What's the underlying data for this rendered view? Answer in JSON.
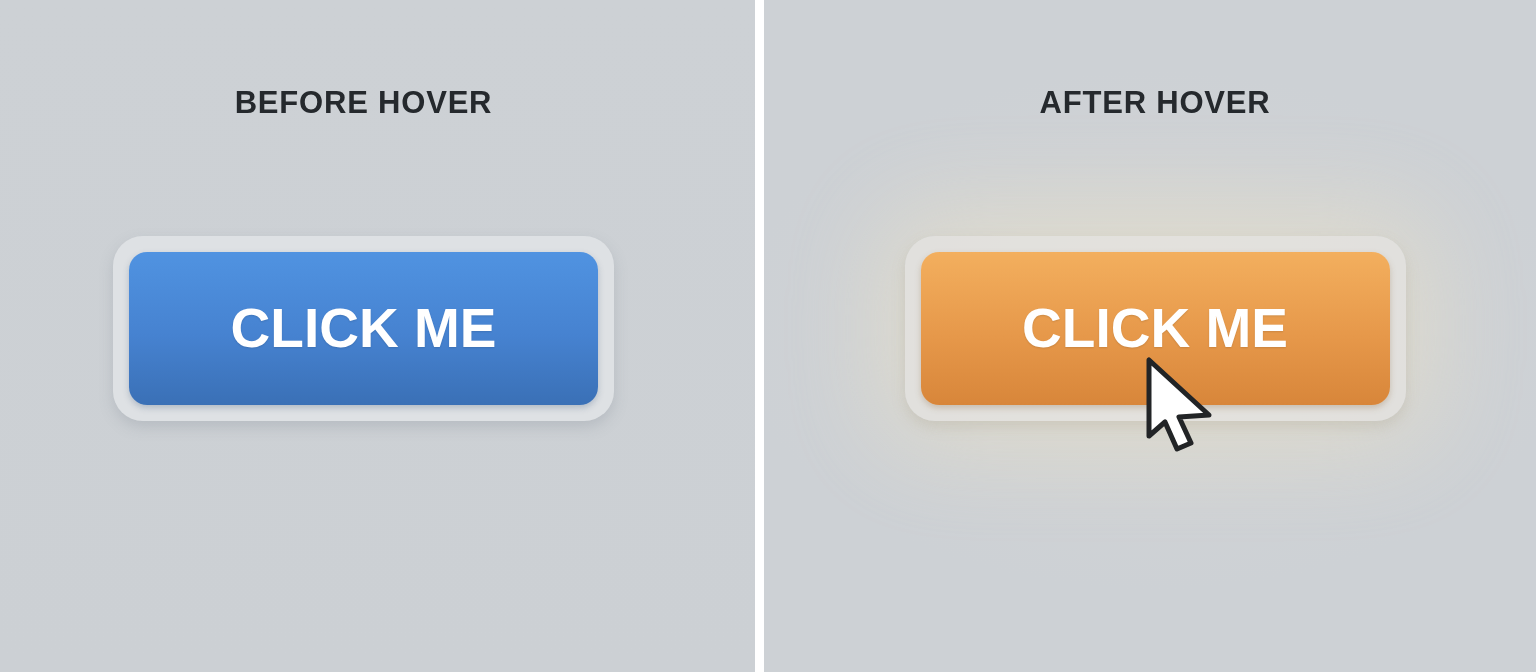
{
  "panels": [
    {
      "title": "BEFORE HOVER",
      "button": {
        "label": "CLICK ME",
        "hovered": false
      }
    },
    {
      "title": "AFTER HOVER",
      "button": {
        "label": "CLICK ME",
        "hovered": true
      }
    }
  ]
}
